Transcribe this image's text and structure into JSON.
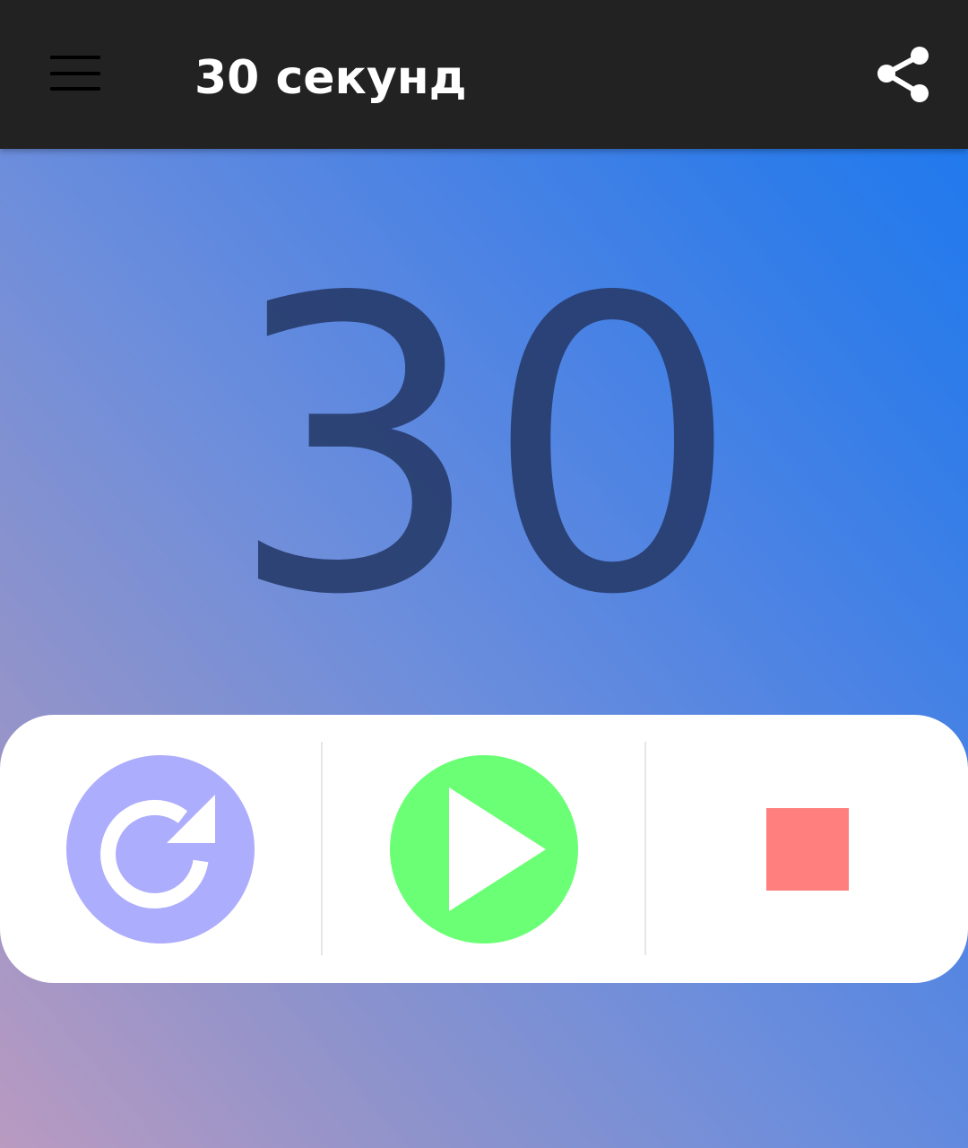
{
  "app_bar": {
    "title": "30 секунд",
    "menu_icon": "hamburger-menu-icon",
    "share_icon": "share-icon",
    "background_color": "#222222"
  },
  "timer": {
    "value": "30"
  },
  "controls": {
    "restart": {
      "icon": "restart-icon",
      "color": "#adadfd"
    },
    "play": {
      "icon": "play-icon",
      "color": "#6bff75"
    },
    "stop": {
      "icon": "stop-icon",
      "color": "#ff7f7f"
    }
  }
}
